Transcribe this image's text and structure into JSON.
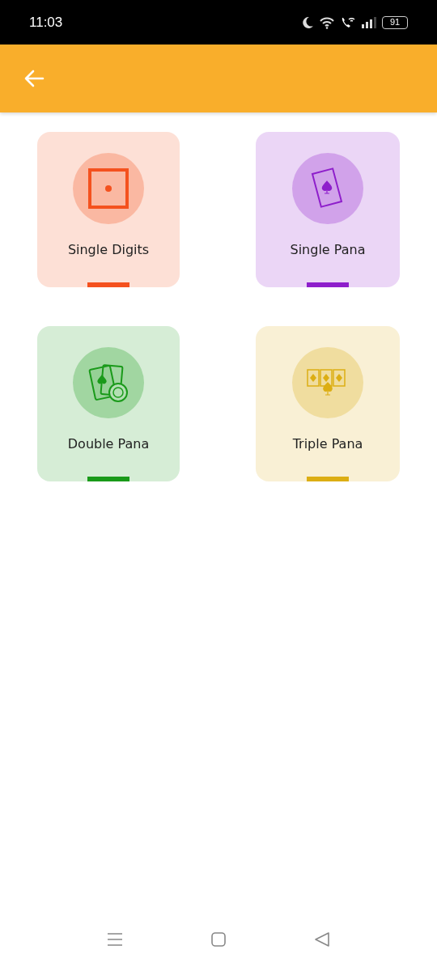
{
  "status_bar": {
    "time": "11:03",
    "battery": "91"
  },
  "cards": [
    {
      "label": "Single Digits",
      "kind": "dice",
      "color": "#f4511e"
    },
    {
      "label": "Single Pana",
      "kind": "card",
      "color": "#8e1ecb"
    },
    {
      "label": "Double Pana",
      "kind": "cards-chip",
      "color": "#1a9a1a"
    },
    {
      "label": "Triple Pana",
      "kind": "three-cards",
      "color": "#dcae14"
    }
  ]
}
